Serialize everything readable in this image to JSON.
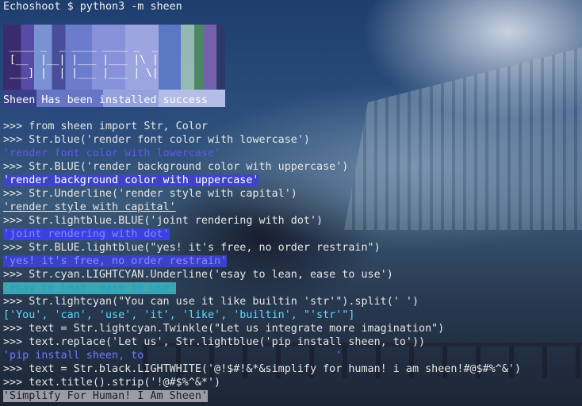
{
  "prompt": {
    "host": "Echoshoot",
    "symbol": "$",
    "command": "python3 -m sheen"
  },
  "banner": {
    "art": [
      " ____ _  _ ____ ____ _  _",
      " [__  |__| |___ |___ |\\ |",
      " ___] |  | |___ |___ | \\|"
    ],
    "message": "Sheen Has been installed success"
  },
  "repl": {
    "ps": ">>>",
    "lines": [
      {
        "type": "in",
        "text": "from sheen import Str, Color"
      },
      {
        "type": "in",
        "text": "Str.blue('render font color with lowercase')"
      },
      {
        "type": "out",
        "text": "'render font color with lowercase'"
      },
      {
        "type": "in",
        "text": "Str.BLUE('render background color with uppercase')"
      },
      {
        "type": "out",
        "text": "'render background color with uppercase'"
      },
      {
        "type": "in",
        "text": "Str.Underline('render style with capital')"
      },
      {
        "type": "out",
        "text": "'render style with capital'"
      },
      {
        "type": "in",
        "text": "Str.lightblue.BLUE('joint rendering with dot')"
      },
      {
        "type": "out",
        "text": "'joint rendering with dot'"
      },
      {
        "type": "in",
        "text": "Str.BLUE.lightblue(\"yes! it's free, no order restrain\")"
      },
      {
        "type": "out",
        "text": "'yes! it's free, no order restrain'"
      },
      {
        "type": "in",
        "text": "Str.cyan.LIGHTCYAN.Underline('esay to lean, ease to use')"
      },
      {
        "type": "out",
        "text": "'esay to lean, ease to use'"
      },
      {
        "type": "in",
        "text": "Str.lightcyan(\"You can use it like builtin 'str'\").split(' ')"
      },
      {
        "type": "out",
        "text": "['You', 'can', 'use', 'it', 'like', 'builtin', \"'str'\"]"
      },
      {
        "type": "in",
        "text": "text = Str.lightcyan.Twinkle(\"Let us integrate more imagination\")"
      },
      {
        "type": "in",
        "text": "text.replace('Let us', Str.lightblue('pip install sheen, to'))"
      },
      {
        "type": "out",
        "text": "'pip install sheen, to                              '"
      },
      {
        "type": "in",
        "text": "text = Str.black.LIGHTWHITE('@!$#!&*&simplify for human! i am sheen!#@$#%^&')"
      },
      {
        "type": "in",
        "text": "text.title().strip('!@#$%^&*')"
      },
      {
        "type": "out",
        "text": "'Simplify For Human! I Am Sheen'"
      }
    ]
  },
  "colors": {
    "blue": "#5b5bf0",
    "bg_blue": "#3f43c8",
    "lightblue": "#6c6cff",
    "lightcyan": "#5fd8ff",
    "lightwhite_bg": "#9c9ca8"
  }
}
